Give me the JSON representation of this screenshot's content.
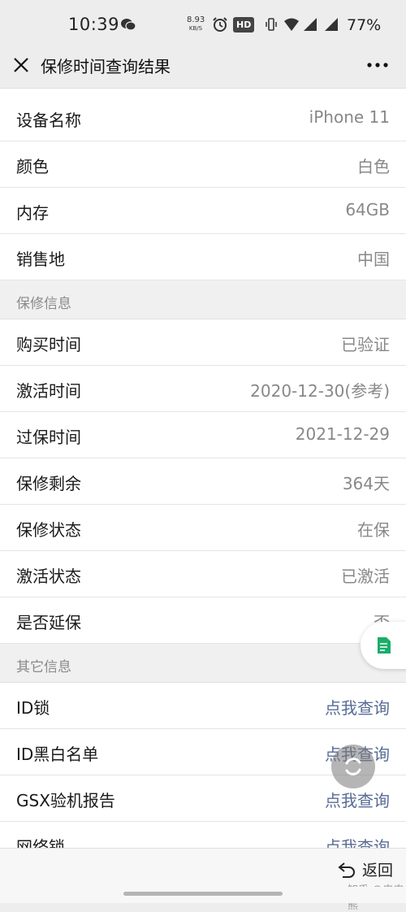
{
  "status_bar": {
    "time": "10:39",
    "net_speed_value": "8.93",
    "net_speed_unit": "KB/S",
    "hd_badge": "HD",
    "battery_text": "77%"
  },
  "nav": {
    "title": "保修时间查询结果"
  },
  "device": {
    "rows": [
      {
        "label": "设备名称",
        "value": "iPhone 11"
      },
      {
        "label": "颜色",
        "value": "白色"
      },
      {
        "label": "内存",
        "value": "64GB"
      },
      {
        "label": "销售地",
        "value": "中国"
      }
    ]
  },
  "warranty": {
    "header": "保修信息",
    "rows": [
      {
        "label": "购买时间",
        "value": "已验证"
      },
      {
        "label": "激活时间",
        "value": "2020-12-30(参考)"
      },
      {
        "label": "过保时间",
        "value": "2021-12-29"
      },
      {
        "label": "保修剩余",
        "value": "364天"
      },
      {
        "label": "保修状态",
        "value": "在保"
      },
      {
        "label": "激活状态",
        "value": "已激活"
      },
      {
        "label": "是否延保",
        "value": "否"
      }
    ]
  },
  "other": {
    "header": "其它信息",
    "rows": [
      {
        "label": "ID锁",
        "value": "点我查询"
      },
      {
        "label": "ID黑白名单",
        "value": "点我查询"
      },
      {
        "label": "GSX验机报告",
        "value": "点我查询"
      },
      {
        "label": "网络锁",
        "value": "点我查询"
      }
    ]
  },
  "bottom": {
    "back_label": "返回",
    "watermark": "知乎 @皮皮熊"
  },
  "colors": {
    "link": "#576b95",
    "value_gray": "#888888",
    "background": "#ededed",
    "doc_icon_green": "#1aad6a"
  }
}
